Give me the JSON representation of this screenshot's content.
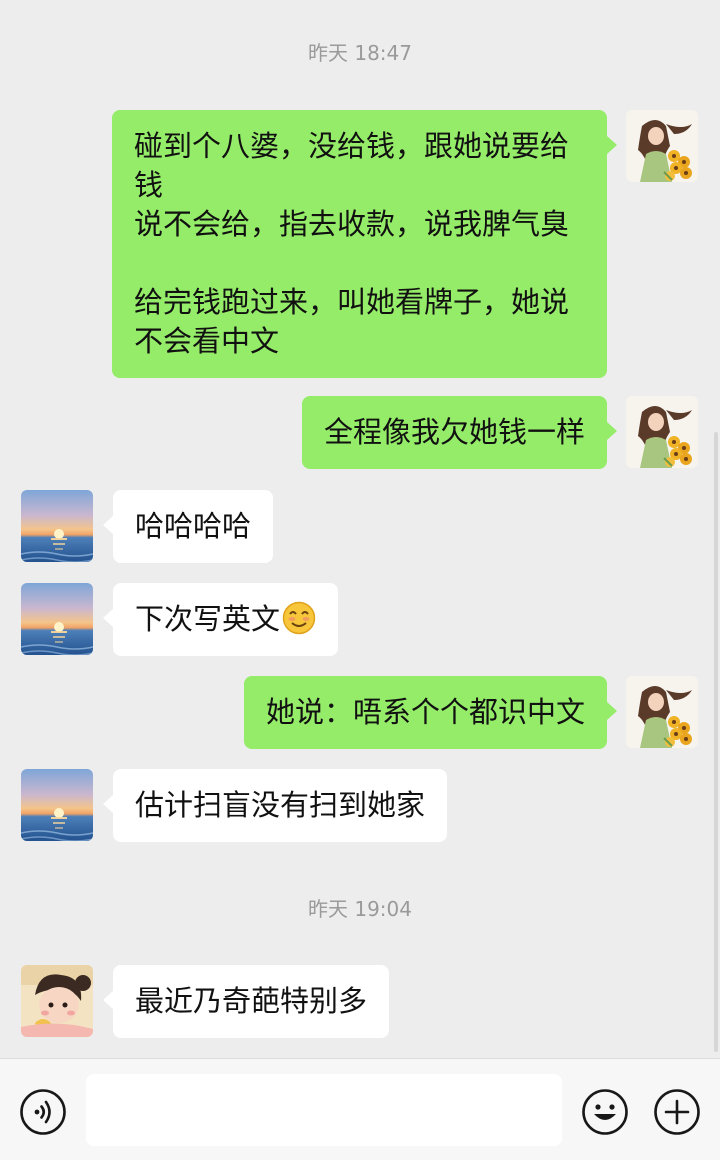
{
  "chat": {
    "timestamps": [
      "昨天 18:47",
      "昨天 19:04"
    ],
    "messages": [
      {
        "side": "right",
        "sender": "me",
        "text": "碰到个八婆，没给钱，跟她说要给钱\n说不会给，指去收款，说我脾气臭\n\n给完钱跑过来，叫她看牌子，她说不会看中文"
      },
      {
        "side": "right",
        "sender": "me",
        "text": "全程像我欠她钱一样"
      },
      {
        "side": "left",
        "sender": "friend-sunset",
        "text": "哈哈哈哈"
      },
      {
        "side": "left",
        "sender": "friend-sunset",
        "text": "下次写英文",
        "emoji": "smiling-emoji"
      },
      {
        "side": "right",
        "sender": "me",
        "text": "她说：唔系个个都识中文"
      },
      {
        "side": "left",
        "sender": "friend-sunset",
        "text": "估计扫盲没有扫到她家"
      },
      {
        "side": "left",
        "sender": "friend-cartoon",
        "text": "最近乃奇葩特别多"
      }
    ]
  },
  "input_bar": {
    "voice_icon": "voice-icon",
    "text_value": "",
    "emoji_icon": "emoji-icon",
    "add_icon": "plus-icon"
  },
  "colors": {
    "background": "#ededed",
    "my_bubble": "#95ec69",
    "their_bubble": "#ffffff",
    "timestamp": "#9a9a9a"
  }
}
